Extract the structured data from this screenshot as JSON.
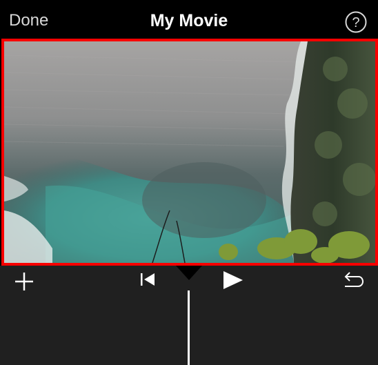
{
  "topbar": {
    "done_label": "Done",
    "title": "My Movie",
    "help_label": "?"
  },
  "preview": {
    "highlight_color": "#f80000"
  },
  "controls": {
    "add_icon": "plus-icon",
    "skip_back_icon": "skip-to-start-icon",
    "play_icon": "play-icon",
    "undo_icon": "undo-icon"
  },
  "colors": {
    "background": "#000000",
    "control_bar": "#202020",
    "text_primary": "#ffffff",
    "text_secondary": "#d8d8d8"
  }
}
